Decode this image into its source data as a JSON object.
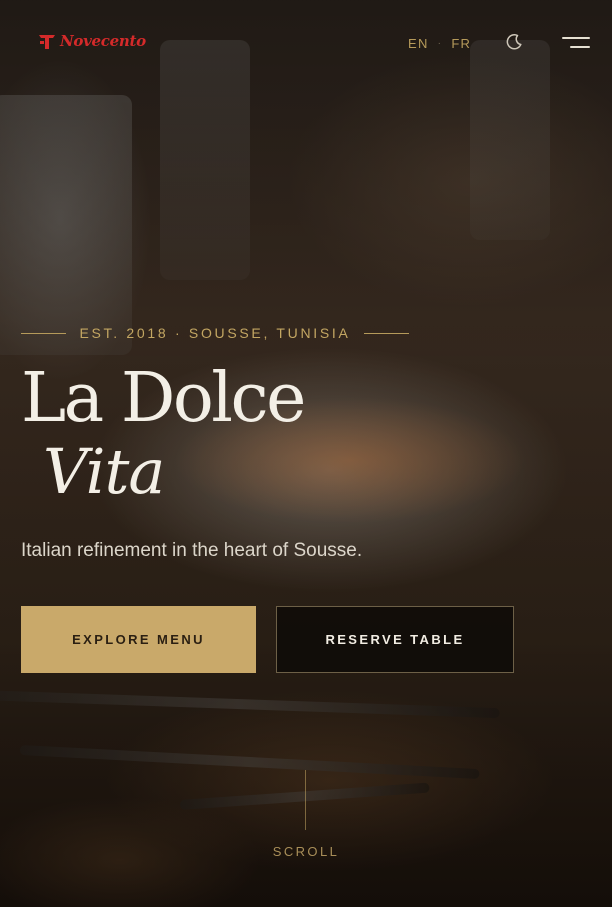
{
  "header": {
    "logo_text": "Novecento",
    "languages": [
      "EN",
      "FR"
    ],
    "language_separator": "·",
    "theme_toggle_icon": "moon-icon",
    "menu_icon": "hamburger-menu-icon"
  },
  "hero": {
    "eyebrow": "EST. 2018 · SOUSSE, TUNISIA",
    "title_line1": "La Dolce",
    "title_line2": "Vita",
    "tagline": "Italian refinement in the heart of Sousse.",
    "primary_cta": "EXPLORE MENU",
    "secondary_cta": "RESERVE TABLE",
    "scroll_label": "SCROLL"
  },
  "colors": {
    "accent_gold": "#c9a96a",
    "brand_red": "#d42a2a",
    "text_light": "#f3efe6",
    "button_dark": "#0c0907"
  }
}
